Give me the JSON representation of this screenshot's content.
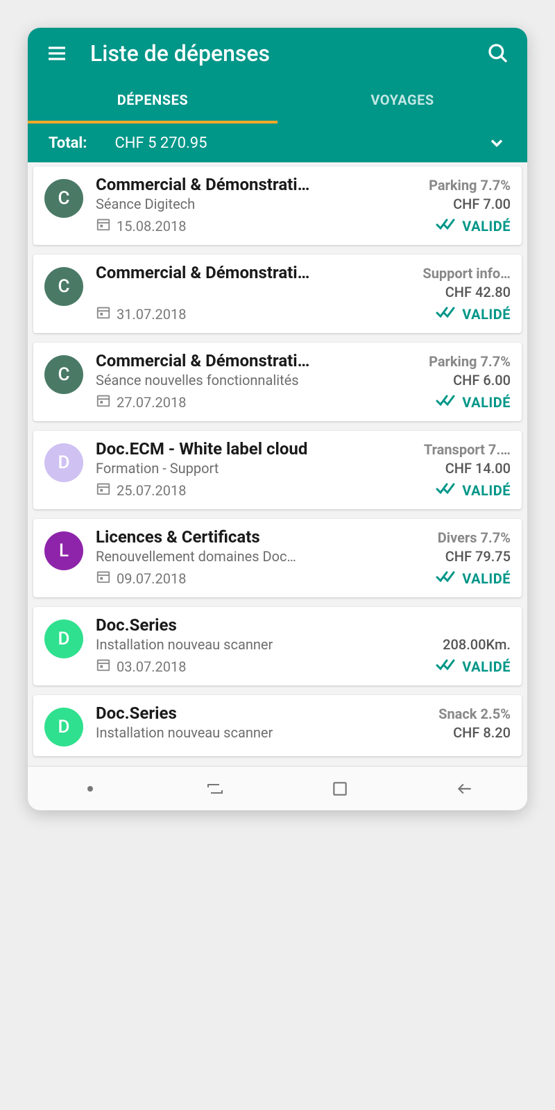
{
  "header": {
    "title": "Liste de dépenses",
    "tabs": [
      {
        "label": "DÉPENSES",
        "active": true
      },
      {
        "label": "VOYAGES",
        "active": false
      }
    ]
  },
  "totalbar": {
    "label": "Total:",
    "value": "CHF 5 270.95"
  },
  "status_label": "VALIDÉ",
  "expenses": [
    {
      "avatar_letter": "C",
      "avatar_color": "#4a7a66",
      "title": "Commercial & Démonstrati…",
      "tag": "Parking 7.7%",
      "subtitle": "Séance Digitech",
      "amount": "CHF 7.00",
      "date": "15.08.2018",
      "status": "VALIDÉ"
    },
    {
      "avatar_letter": "C",
      "avatar_color": "#4a7a66",
      "title": "Commercial & Démonstrati…",
      "tag": "Support info…",
      "subtitle": "",
      "amount": "CHF 42.80",
      "date": "31.07.2018",
      "status": "VALIDÉ"
    },
    {
      "avatar_letter": "C",
      "avatar_color": "#4a7a66",
      "title": "Commercial & Démonstrati…",
      "tag": "Parking 7.7%",
      "subtitle": "Séance nouvelles fonctionnalités",
      "amount": "CHF 6.00",
      "date": "27.07.2018",
      "status": "VALIDÉ"
    },
    {
      "avatar_letter": "D",
      "avatar_color": "#cfc1f2",
      "title": "Doc.ECM - White label cloud",
      "tag": "Transport 7.…",
      "subtitle": "Formation - Support",
      "amount": "CHF 14.00",
      "date": "25.07.2018",
      "status": "VALIDÉ"
    },
    {
      "avatar_letter": "L",
      "avatar_color": "#8e24aa",
      "title": "Licences & Certificats",
      "tag": "Divers 7.7%",
      "subtitle": "Renouvellement domaines Doc…",
      "amount": "CHF 79.75",
      "date": "09.07.2018",
      "status": "VALIDÉ"
    },
    {
      "avatar_letter": "D",
      "avatar_color": "#2fe08e",
      "title": "Doc.Series",
      "tag": "",
      "subtitle": "Installation nouveau scanner",
      "amount": "208.00Km.",
      "date": "03.07.2018",
      "status": "VALIDÉ"
    },
    {
      "avatar_letter": "D",
      "avatar_color": "#2fe08e",
      "title": "Doc.Series",
      "tag": "Snack 2.5%",
      "subtitle": "Installation nouveau scanner",
      "amount": "CHF 8.20",
      "date": "",
      "status": ""
    }
  ]
}
